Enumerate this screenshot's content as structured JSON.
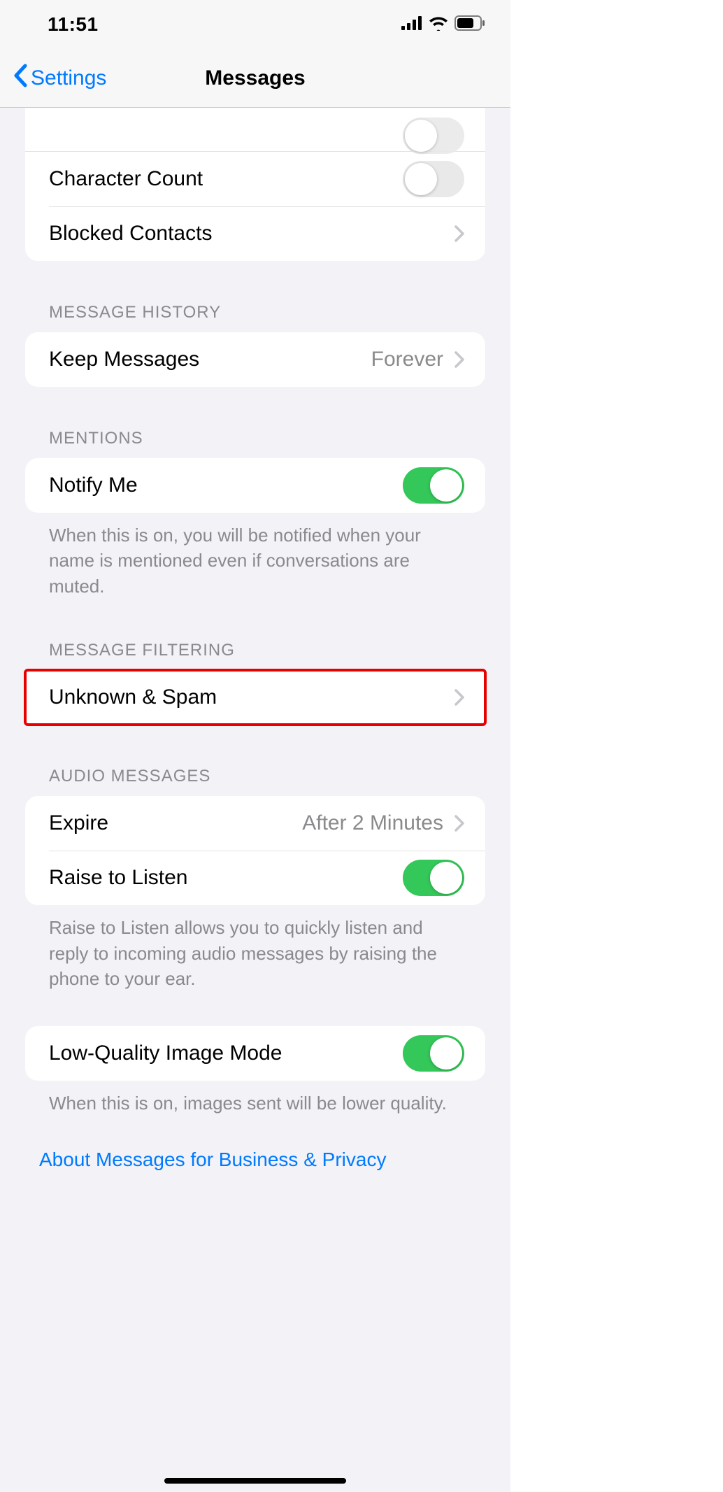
{
  "status": {
    "time": "11:51"
  },
  "nav": {
    "back": "Settings",
    "title": "Messages"
  },
  "top_group": {
    "character_count": {
      "label": "Character Count",
      "on": false
    },
    "blocked": {
      "label": "Blocked Contacts"
    }
  },
  "history": {
    "header": "MESSAGE HISTORY",
    "keep": {
      "label": "Keep Messages",
      "value": "Forever"
    }
  },
  "mentions": {
    "header": "MENTIONS",
    "notify": {
      "label": "Notify Me",
      "on": true
    },
    "footer": "When this is on, you will be notified when your name is mentioned even if conversations are muted."
  },
  "filtering": {
    "header": "MESSAGE FILTERING",
    "unknown": {
      "label": "Unknown & Spam"
    }
  },
  "audio": {
    "header": "AUDIO MESSAGES",
    "expire": {
      "label": "Expire",
      "value": "After 2 Minutes"
    },
    "raise": {
      "label": "Raise to Listen",
      "on": true
    },
    "footer": "Raise to Listen allows you to quickly listen and reply to incoming audio messages by raising the phone to your ear."
  },
  "lowq": {
    "row": {
      "label": "Low-Quality Image Mode",
      "on": true
    },
    "footer": "When this is on, images sent will be lower quality."
  },
  "link": {
    "label": "About Messages for Business & Privacy"
  }
}
